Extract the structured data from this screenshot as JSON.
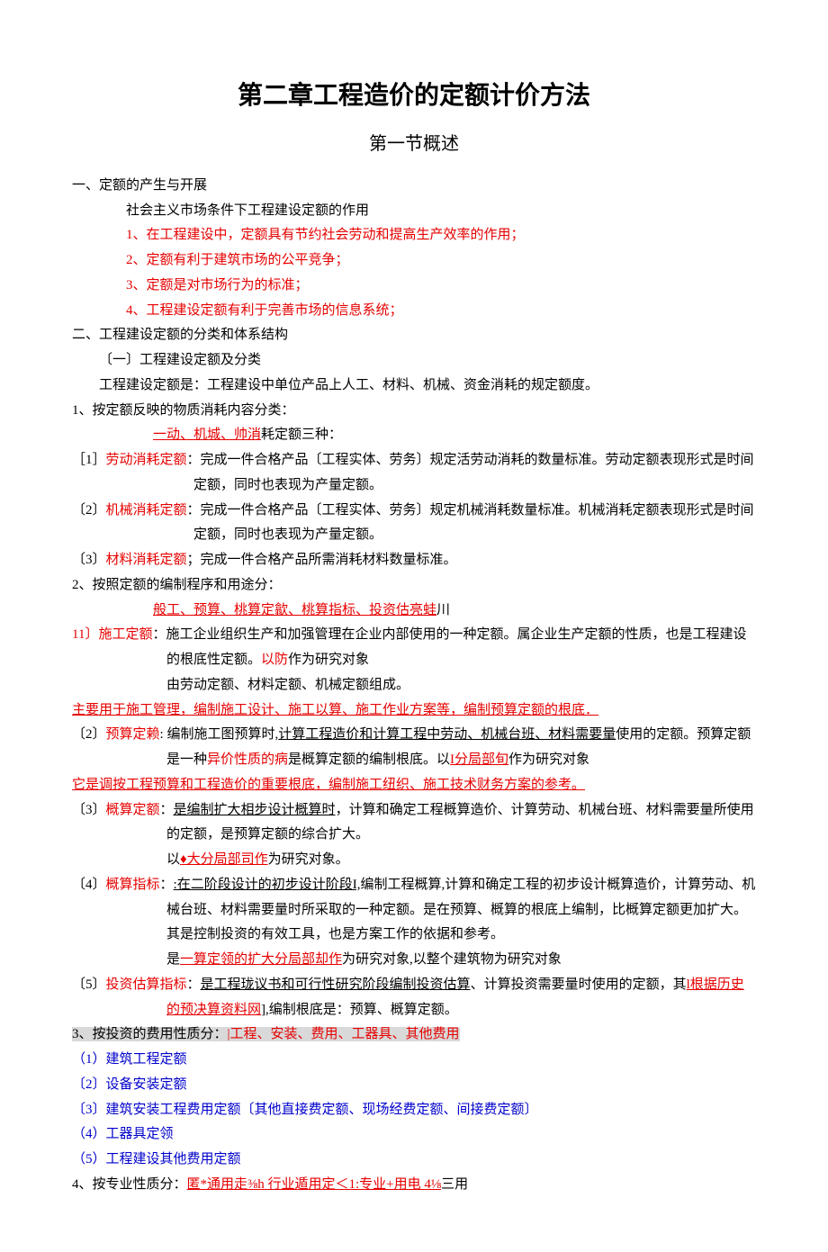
{
  "title": "第二章工程造价的定额计价方法",
  "subtitle": "第一节概述",
  "s1": {
    "h": "一、定额的产生与开展",
    "l1": "社会主义市场条件下工程建设定额的作用",
    "l2": "1、在工程建设中，定额具有节约社会劳动和提高生产效率的作用；",
    "l3": "2、定额有利于建筑市场的公平竞争；",
    "l4": "3、定额是对市场行为的标准；",
    "l5": "4、工程建设定额有利于完善市场的信息系统；"
  },
  "s2": {
    "h": "二、工程建设定额的分类和体系结构",
    "l1": "〔一〕工程建设定额及分类",
    "l2": "工程建设定额是：工程建设中单位产品上人工、材料、机械、资金消耗的规定额度。"
  },
  "c1": {
    "h": "1、按定额反映的物质消耗内容分类：",
    "u1": "一动、机城、帅消",
    "u1b": "耗定额三种：",
    "i1a": "［1］",
    "i1b": "劳动消耗定额",
    "i1c": "：完成一件合格产品〔工程实体、劳务〕规定活劳动消耗的数量标准。劳动定额表现形式是时间定额，同时也表现为产量定额。",
    "i2a": "〔2〕",
    "i2b": "机械消耗定额",
    "i2c": "：完成一件合格产品〔工程实体、劳务〕规定机械消耗数量标准。机械消耗定额表现形式是时间定额，同时也表现为产量定额。",
    "i3a": "〔3〕",
    "i3b": "材料消耗定额",
    "i3c": "；完成一件合格产品所需消耗材料数量标准。"
  },
  "c2": {
    "h": "2、按照定额的编制程序和用途分：",
    "u1": "般工、预算、桃算定歙、桃算指标、投资估亮蛙",
    "u1b": "川",
    "i1a": "11〕",
    "i1b": "施工定额",
    "i1c": "：施工企业组织生产和加强管理在企业内部使用的一种定额。属企业生产定额的性质，也是工程建设的根底性定额。",
    "i1d": "以防",
    "i1e": "作为研究对象",
    "i1f": "由劳动定额、材料定额、机械定额组成。",
    "note1": "主要用于施工管理，编制施工设计、施工以算、施工作业方案等，编制预算定额的根底．",
    "i2a": "〔2〕",
    "i2b": "预算定赖",
    "i2c": ": 编制施工图预算时,",
    "i2d": "计算工程造价和计算工程中劳动、机械台班、材料需要量",
    "i2e": "使用的定额。预算定额是一种",
    "i2f": "异价性质的病",
    "i2g": "是概算定额的编制根底。以",
    "i2h": "I分局部旬",
    "i2i": "作为研究对象",
    "note2": "它是调按工程预算和工程造价的重要根底，编制施工纽织、施工技术财务方案的参考。",
    "i3a": "〔3〕",
    "i3b": "概算定额",
    "i3c": "：",
    "i3d": "是编制扩大相步设计概算时",
    "i3e": "，计算和确定工程概算造价、计算劳动、机械台班、材料需要量所使用的定额，是预算定额的综合扩大。",
    "i3f": "以",
    "i3g": "♦大分局部司作",
    "i3h": "为研究对象。",
    "i4a": "〔4〕",
    "i4b": "概算指标",
    "i4c": "：",
    "i4d": ":在二阶段设计的初步设计阶段I,",
    "i4e": "编制工程概算,计算和确定工程的初步设计概算造价，计算劳动、机械台班、材料需要量时所采取的一种定额。是在预算、概算的根底上编制，比概算定额更加扩大。其是控制投资的有效工具，也是方案工作的依据和参考。",
    "i4f": "是",
    "i4g": "一算定领的扩大分局部却作",
    "i4h": "为研究对象,以整个建筑物为研究对象",
    "i5a": "〔5〕",
    "i5b": "投资估算指标",
    "i5c": "：",
    "i5d": "是工程珑议书和可行性研究阶段编制投资估算",
    "i5e": "、计算投资需要量时使用的定额，其",
    "i5f": "l根据历史的预决算资料网",
    "i5g": "],编制根底是：预算、概算定额。"
  },
  "c3": {
    "h_a": "3、按投资的费用性质分：",
    "h_b": "|工程、安装、费用、工器具、其他费用",
    "l1": "（1）建筑工程定额",
    "l2": "〔2〕设备安装定额",
    "l3": "〔3〕建筑安装工程费用定额〔其他直接费定额、现场经费定额、间接费定额〕",
    "l4": "（4）工器具定领",
    "l5": "（5）工程建设其他费用定额"
  },
  "c4": {
    "h_a": "4、按专业性质分：",
    "h_b": "匿*通用走⅜h 行业遁用定＜1:专业+用电 4⅛",
    "h_c": "三用"
  }
}
